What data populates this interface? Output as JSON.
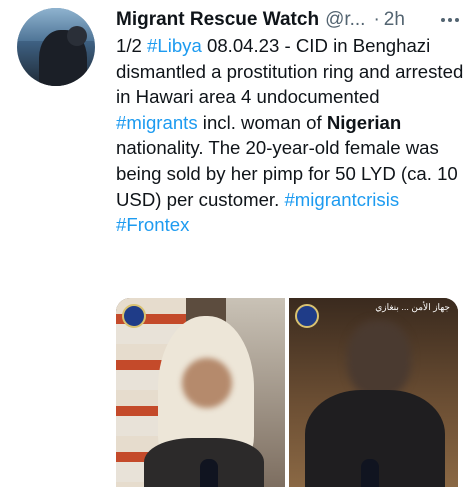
{
  "tweet": {
    "author_name": "Migrant Rescue Watch",
    "handle": "@r...",
    "separator": "·",
    "time": "2h",
    "text": {
      "p1": "1/2 ",
      "tag_libya": "#Libya",
      "p2": " 08.04.23 - CID in Benghazi dismantled a prostitution ring and arrested in Hawari area 4 undocumented ",
      "tag_migrants": "#migrants",
      "p3": " incl. woman of ",
      "nigerian": "Nigerian",
      "p4": " nationality. The 20-year-old female was being sold by her pimp for 50 LYD (ca. 10 USD) per customer. ",
      "tag_migrantcrisis": "#migrantcrisis",
      "tag_frontex": "#Frontex"
    },
    "media": {
      "right_caption": "جهاز الأمن ... بنغازي"
    }
  },
  "colors": {
    "link": "#1d9bf0",
    "muted": "#536471",
    "text": "#0f1419"
  },
  "icons": [
    "more-icon",
    "police-logo-icon"
  ]
}
